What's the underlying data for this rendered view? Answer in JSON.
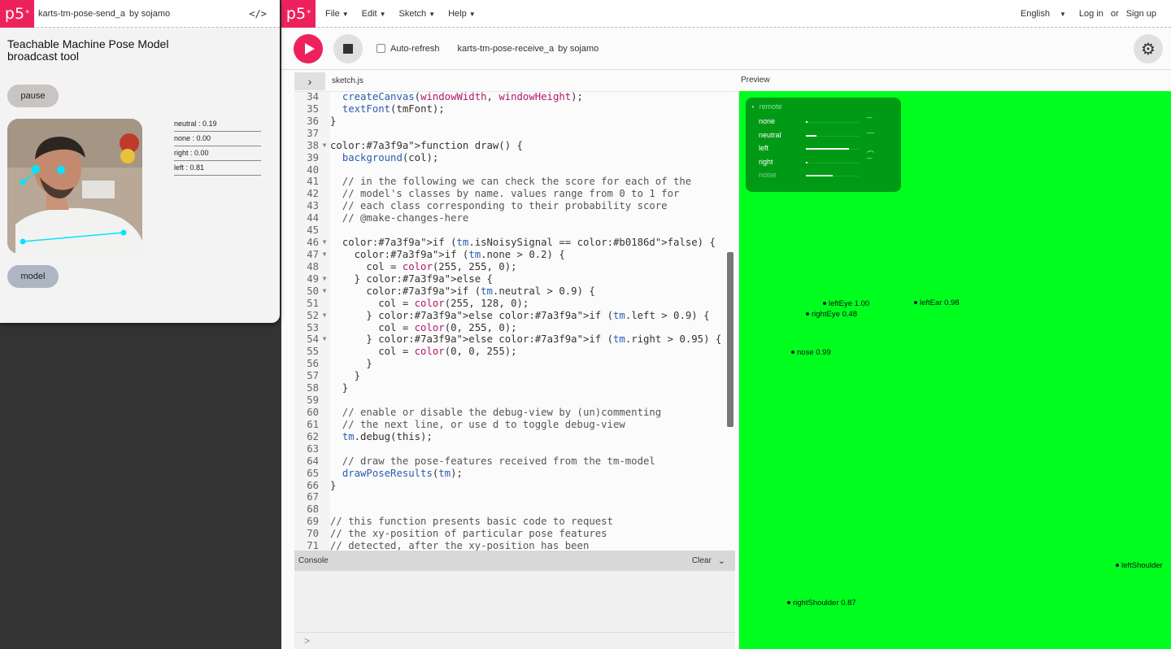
{
  "left_window": {
    "logo": "p5",
    "sketch_title": "karts-tm-pose-send_a",
    "by": "by",
    "author": "sojamo",
    "code_icon": "</>",
    "heading_line1": "Teachable Machine Pose Model",
    "heading_line2": "broadcast tool",
    "pause_label": "pause",
    "model_label": "model",
    "scores": [
      "neutral : 0.19",
      "none : 0.00",
      "right : 0.00",
      "left : 0.81"
    ]
  },
  "main": {
    "logo": "p5",
    "menu": [
      "File",
      "Edit",
      "Sketch",
      "Help"
    ],
    "language": "English",
    "login": "Log in",
    "or": "or",
    "signup": "Sign up",
    "auto_refresh": "Auto-refresh",
    "sketch_title": "karts-tm-pose-receive_a",
    "by": "by",
    "author": "sojamo",
    "filename": "sketch.js",
    "preview_label": "Preview",
    "console_label": "Console",
    "clear_label": "Clear",
    "console_prompt": ">"
  },
  "code_lines": [
    {
      "n": "34",
      "fold": false,
      "t": "  createCanvas(windowWidth, windowHeight);"
    },
    {
      "n": "35",
      "fold": false,
      "t": "  textFont(tmFont);"
    },
    {
      "n": "36",
      "fold": false,
      "t": "}"
    },
    {
      "n": "37",
      "fold": false,
      "t": ""
    },
    {
      "n": "38",
      "fold": true,
      "t": "function draw() {"
    },
    {
      "n": "39",
      "fold": false,
      "t": "  background(col);"
    },
    {
      "n": "40",
      "fold": false,
      "t": ""
    },
    {
      "n": "41",
      "fold": false,
      "t": "  // in the following we can check the score for each of the"
    },
    {
      "n": "42",
      "fold": false,
      "t": "  // model's classes by name. values range from 0 to 1 for"
    },
    {
      "n": "43",
      "fold": false,
      "t": "  // each class corresponding to their probability score"
    },
    {
      "n": "44",
      "fold": false,
      "t": "  // @make-changes-here"
    },
    {
      "n": "45",
      "fold": false,
      "t": ""
    },
    {
      "n": "46",
      "fold": true,
      "t": "  if (tm.isNoisySignal == false) {"
    },
    {
      "n": "47",
      "fold": true,
      "t": "    if (tm.none > 0.2) {"
    },
    {
      "n": "48",
      "fold": false,
      "t": "      col = color(255, 255, 0);"
    },
    {
      "n": "49",
      "fold": true,
      "t": "    } else {"
    },
    {
      "n": "50",
      "fold": true,
      "t": "      if (tm.neutral > 0.9) {"
    },
    {
      "n": "51",
      "fold": false,
      "t": "        col = color(255, 128, 0);"
    },
    {
      "n": "52",
      "fold": true,
      "t": "      } else if (tm.left > 0.9) {"
    },
    {
      "n": "53",
      "fold": false,
      "t": "        col = color(0, 255, 0);"
    },
    {
      "n": "54",
      "fold": true,
      "t": "      } else if (tm.right > 0.95) {"
    },
    {
      "n": "55",
      "fold": false,
      "t": "        col = color(0, 0, 255);"
    },
    {
      "n": "56",
      "fold": false,
      "t": "      }"
    },
    {
      "n": "57",
      "fold": false,
      "t": "    }"
    },
    {
      "n": "58",
      "fold": false,
      "t": "  }"
    },
    {
      "n": "59",
      "fold": false,
      "t": ""
    },
    {
      "n": "60",
      "fold": false,
      "t": "  // enable or disable the debug-view by (un)commenting"
    },
    {
      "n": "61",
      "fold": false,
      "t": "  // the next line, or use d to toggle debug-view"
    },
    {
      "n": "62",
      "fold": false,
      "t": "  tm.debug(this);"
    },
    {
      "n": "63",
      "fold": false,
      "t": ""
    },
    {
      "n": "64",
      "fold": false,
      "t": "  // draw the pose-features received from the tm-model"
    },
    {
      "n": "65",
      "fold": false,
      "t": "  drawPoseResults(tm);"
    },
    {
      "n": "66",
      "fold": false,
      "t": "}"
    },
    {
      "n": "67",
      "fold": false,
      "t": ""
    },
    {
      "n": "68",
      "fold": false,
      "t": ""
    },
    {
      "n": "69",
      "fold": false,
      "t": "// this function presents basic code to request"
    },
    {
      "n": "70",
      "fold": false,
      "t": "// the xy-position of particular pose features"
    },
    {
      "n": "71",
      "fold": false,
      "t": "// detected, after the xy-position has been"
    }
  ],
  "remote_panel": {
    "title": "remote",
    "rows": [
      {
        "label": "none",
        "level": 0.0,
        "dim": false
      },
      {
        "label": "neutral",
        "level": 0.19,
        "dim": false
      },
      {
        "label": "left",
        "level": 0.81,
        "dim": false
      },
      {
        "label": "right",
        "level": 0.0,
        "dim": false
      },
      {
        "label": "noise",
        "level": 0.5,
        "dim": true
      }
    ]
  },
  "keypoints": [
    {
      "label": "leftEye 1.00"
    },
    {
      "label": "rightEye 0.48"
    },
    {
      "label": "leftEar 0.98"
    },
    {
      "label": "nose 0.99"
    },
    {
      "label": "leftShoulder"
    },
    {
      "label": "rightShoulder 0.87"
    }
  ],
  "colors": {
    "brand": "#ed225d",
    "preview_bg": "#00ff1f",
    "panel_bg": "#009a15"
  }
}
